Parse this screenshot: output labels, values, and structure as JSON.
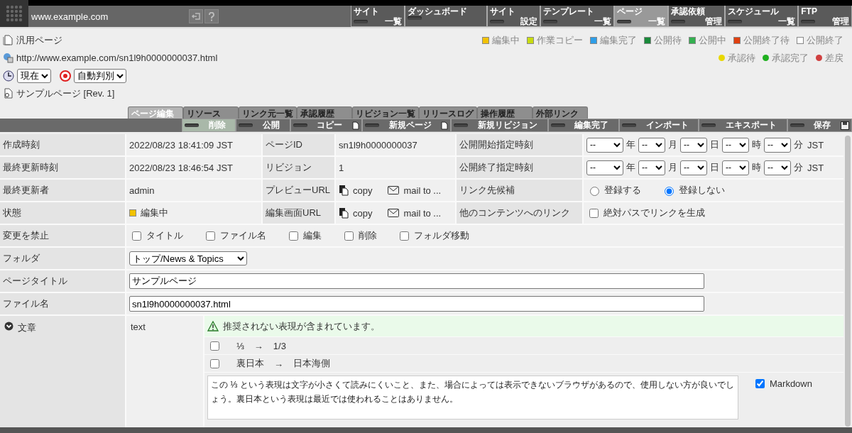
{
  "header": {
    "site": "www.example.com",
    "nav": [
      {
        "top": "サイト",
        "bottom": "一覧",
        "selected": false
      },
      {
        "top": "ダッシュボード",
        "selected": false
      },
      {
        "top": "サイト",
        "bottom": "設定",
        "selected": false
      },
      {
        "top": "テンプレート",
        "bottom": "一覧",
        "selected": false
      },
      {
        "top": "ページ",
        "bottom": "一覧",
        "selected": true
      },
      {
        "top": "承認依頼",
        "bottom": "管理",
        "selected": false
      },
      {
        "top": "スケジュール",
        "bottom": "一覧",
        "selected": false
      },
      {
        "top": "FTP",
        "bottom": "管理",
        "selected": false
      }
    ]
  },
  "page_info": {
    "type": "汎用ページ",
    "url": "http://www.example.com/sn1l9h0000000037.html",
    "time_select": "現在",
    "mode_select": "自動判別",
    "title": "サンプルページ [Rev. 1]"
  },
  "status_legend": [
    {
      "label": "編集中",
      "color": "#f2c200"
    },
    {
      "label": "作業コピー",
      "color": "#c8dc10"
    },
    {
      "label": "編集完了",
      "color": "#2e9ee8"
    },
    {
      "label": "公開待",
      "color": "#1a8a3a"
    },
    {
      "label": "公開中",
      "color": "#34b050"
    },
    {
      "label": "公開終了待",
      "color": "#e04010"
    },
    {
      "label": "公開終了",
      "color": "#ffffff"
    }
  ],
  "approval_legend": [
    {
      "label": "承認待",
      "color": "#e8d800"
    },
    {
      "label": "承認完了",
      "color": "#20b020"
    },
    {
      "label": "差戻",
      "color": "#d04040"
    }
  ],
  "tabs": [
    {
      "label": "ページ編集",
      "selected": true
    },
    {
      "label": "リソース",
      "selected": false
    },
    {
      "label": "リンク元一覧",
      "selected": false
    },
    {
      "label": "承認履歴",
      "selected": false
    },
    {
      "label": "リビジョン一覧",
      "selected": false
    },
    {
      "label": "リリースログ",
      "selected": false
    },
    {
      "label": "操作履歴",
      "selected": false
    },
    {
      "label": "外部リンク",
      "selected": false
    }
  ],
  "toolbar": [
    {
      "label": "削除",
      "kind": "plain",
      "selected": true
    },
    {
      "label": "公開",
      "kind": "plain",
      "selected": false
    },
    {
      "label": "コピー",
      "kind": "doc",
      "selected": false
    },
    {
      "label": "新規ページ",
      "kind": "doc",
      "selected": false
    },
    {
      "label": "新規リビジョン",
      "kind": "plain",
      "selected": false
    },
    {
      "label": "編集完了",
      "kind": "plain",
      "selected": false
    },
    {
      "label": "インポート",
      "kind": "plain",
      "selected": false
    },
    {
      "label": "エキスポート",
      "kind": "plain",
      "selected": false
    },
    {
      "label": "保存",
      "kind": "save",
      "selected": false
    }
  ],
  "properties": [
    {
      "cells": [
        {
          "kind": "label",
          "text": "作成時刻"
        },
        {
          "kind": "text",
          "text": "2022/08/23 18:41:09 JST"
        },
        {
          "kind": "label",
          "text": "ページID"
        },
        {
          "kind": "text",
          "text": "sn1l9h0000000037"
        },
        {
          "kind": "label",
          "text": "公開開始指定時刻"
        },
        {
          "kind": "datetime",
          "fields": [
            {
              "value": "--",
              "unit": "年"
            },
            {
              "value": "--",
              "unit": "月"
            },
            {
              "value": "--",
              "unit": "日"
            },
            {
              "value": "--",
              "unit": "時"
            },
            {
              "value": "--",
              "unit": "分"
            }
          ],
          "zone": "JST"
        }
      ]
    },
    {
      "cells": [
        {
          "kind": "label",
          "text": "最終更新時刻"
        },
        {
          "kind": "text",
          "text": "2022/08/23 18:46:54 JST"
        },
        {
          "kind": "label",
          "text": "リビジョン"
        },
        {
          "kind": "text",
          "text": "1"
        },
        {
          "kind": "label",
          "text": "公開終了指定時刻"
        },
        {
          "kind": "datetime",
          "fields": [
            {
              "value": "--",
              "unit": "年"
            },
            {
              "value": "--",
              "unit": "月"
            },
            {
              "value": "--",
              "unit": "日"
            },
            {
              "value": "--",
              "unit": "時"
            },
            {
              "value": "--",
              "unit": "分"
            }
          ],
          "zone": "JST"
        }
      ]
    },
    {
      "cells": [
        {
          "kind": "label",
          "text": "最終更新者"
        },
        {
          "kind": "text",
          "text": "admin"
        },
        {
          "kind": "label",
          "text": "プレビューURL"
        },
        {
          "kind": "share",
          "copy": "copy",
          "mail": "mail to ..."
        },
        {
          "kind": "label",
          "text": "リンク先候補"
        },
        {
          "kind": "radio",
          "options": [
            {
              "label": "登録する",
              "selected": false
            },
            {
              "label": "登録しない",
              "selected": true
            }
          ]
        }
      ]
    },
    {
      "cells": [
        {
          "kind": "label",
          "text": "状態"
        },
        {
          "kind": "status",
          "text": "編集中",
          "color": "#f2c200"
        },
        {
          "kind": "label",
          "text": "編集画面URL"
        },
        {
          "kind": "share",
          "copy": "copy",
          "mail": "mail to ..."
        },
        {
          "kind": "label",
          "text": "他のコンテンツへのリンク"
        },
        {
          "kind": "checkbox",
          "options": [
            {
              "label": "絶対パスでリンクを生成",
              "checked": false
            }
          ]
        }
      ]
    }
  ],
  "lock": {
    "label": "変更を禁止",
    "options": [
      {
        "label": "タイトル",
        "checked": false
      },
      {
        "label": "ファイル名",
        "checked": false
      },
      {
        "label": "編集",
        "checked": false
      },
      {
        "label": "削除",
        "checked": false
      },
      {
        "label": "フォルダ移動",
        "checked": false
      }
    ]
  },
  "folder": {
    "label": "フォルダ",
    "value": "トップ/News & Topics"
  },
  "page_title": {
    "label": "ページタイトル",
    "value": "サンプルページ"
  },
  "file_name": {
    "label": "ファイル名",
    "value": "sn1l9h0000000037.html"
  },
  "body": {
    "label": "文章",
    "format": "text",
    "warning": "推奨されない表現が含まれています。",
    "suggestions": [
      {
        "from": "⅓",
        "arrow": "→",
        "to": "1/3",
        "checked": false
      },
      {
        "from": "裏日本",
        "arrow": "→",
        "to": "日本海側",
        "checked": false
      }
    ],
    "content": "この ⅓ という表現は文字が小さくて読みにくいこと、また、場合によっては表示できないブラウザがあるので、使用しない方が良いでしょう。裏日本という表現は最近では使われることはありません。",
    "markdown": {
      "label": "Markdown",
      "checked": true
    }
  }
}
